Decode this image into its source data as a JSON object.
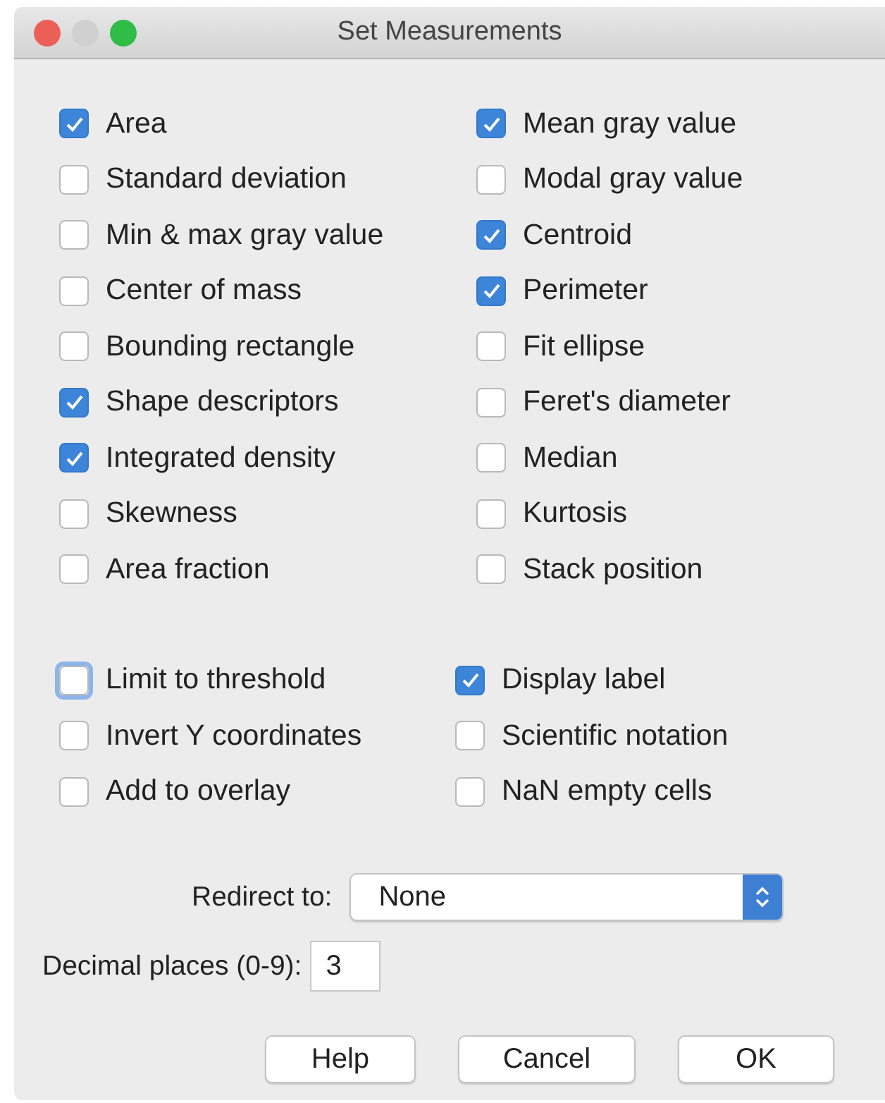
{
  "window": {
    "title": "Set Measurements"
  },
  "measurements": [
    {
      "label": "Area",
      "checked": true
    },
    {
      "label": "Mean gray value",
      "checked": true
    },
    {
      "label": "Standard deviation",
      "checked": false
    },
    {
      "label": "Modal gray value",
      "checked": false
    },
    {
      "label": "Min & max gray value",
      "checked": false
    },
    {
      "label": "Centroid",
      "checked": true
    },
    {
      "label": "Center of mass",
      "checked": false
    },
    {
      "label": "Perimeter",
      "checked": true
    },
    {
      "label": "Bounding rectangle",
      "checked": false
    },
    {
      "label": "Fit ellipse",
      "checked": false
    },
    {
      "label": "Shape descriptors",
      "checked": true
    },
    {
      "label": "Feret's diameter",
      "checked": false
    },
    {
      "label": "Integrated density",
      "checked": true
    },
    {
      "label": "Median",
      "checked": false
    },
    {
      "label": "Skewness",
      "checked": false
    },
    {
      "label": "Kurtosis",
      "checked": false
    },
    {
      "label": "Area fraction",
      "checked": false
    },
    {
      "label": "Stack position",
      "checked": false
    }
  ],
  "options": [
    {
      "label": "Limit to threshold",
      "checked": false,
      "focused": true
    },
    {
      "label": "Display label",
      "checked": true,
      "focused": false
    },
    {
      "label": "Invert Y coordinates",
      "checked": false,
      "focused": false
    },
    {
      "label": "Scientific notation",
      "checked": false,
      "focused": false
    },
    {
      "label": "Add to overlay",
      "checked": false,
      "focused": false
    },
    {
      "label": "NaN empty cells",
      "checked": false,
      "focused": false
    }
  ],
  "redirect": {
    "label": "Redirect to:",
    "value": "None"
  },
  "decimal_places": {
    "label": "Decimal places (0-9):",
    "value": "3"
  },
  "buttons": [
    "Help",
    "Cancel",
    "OK"
  ]
}
